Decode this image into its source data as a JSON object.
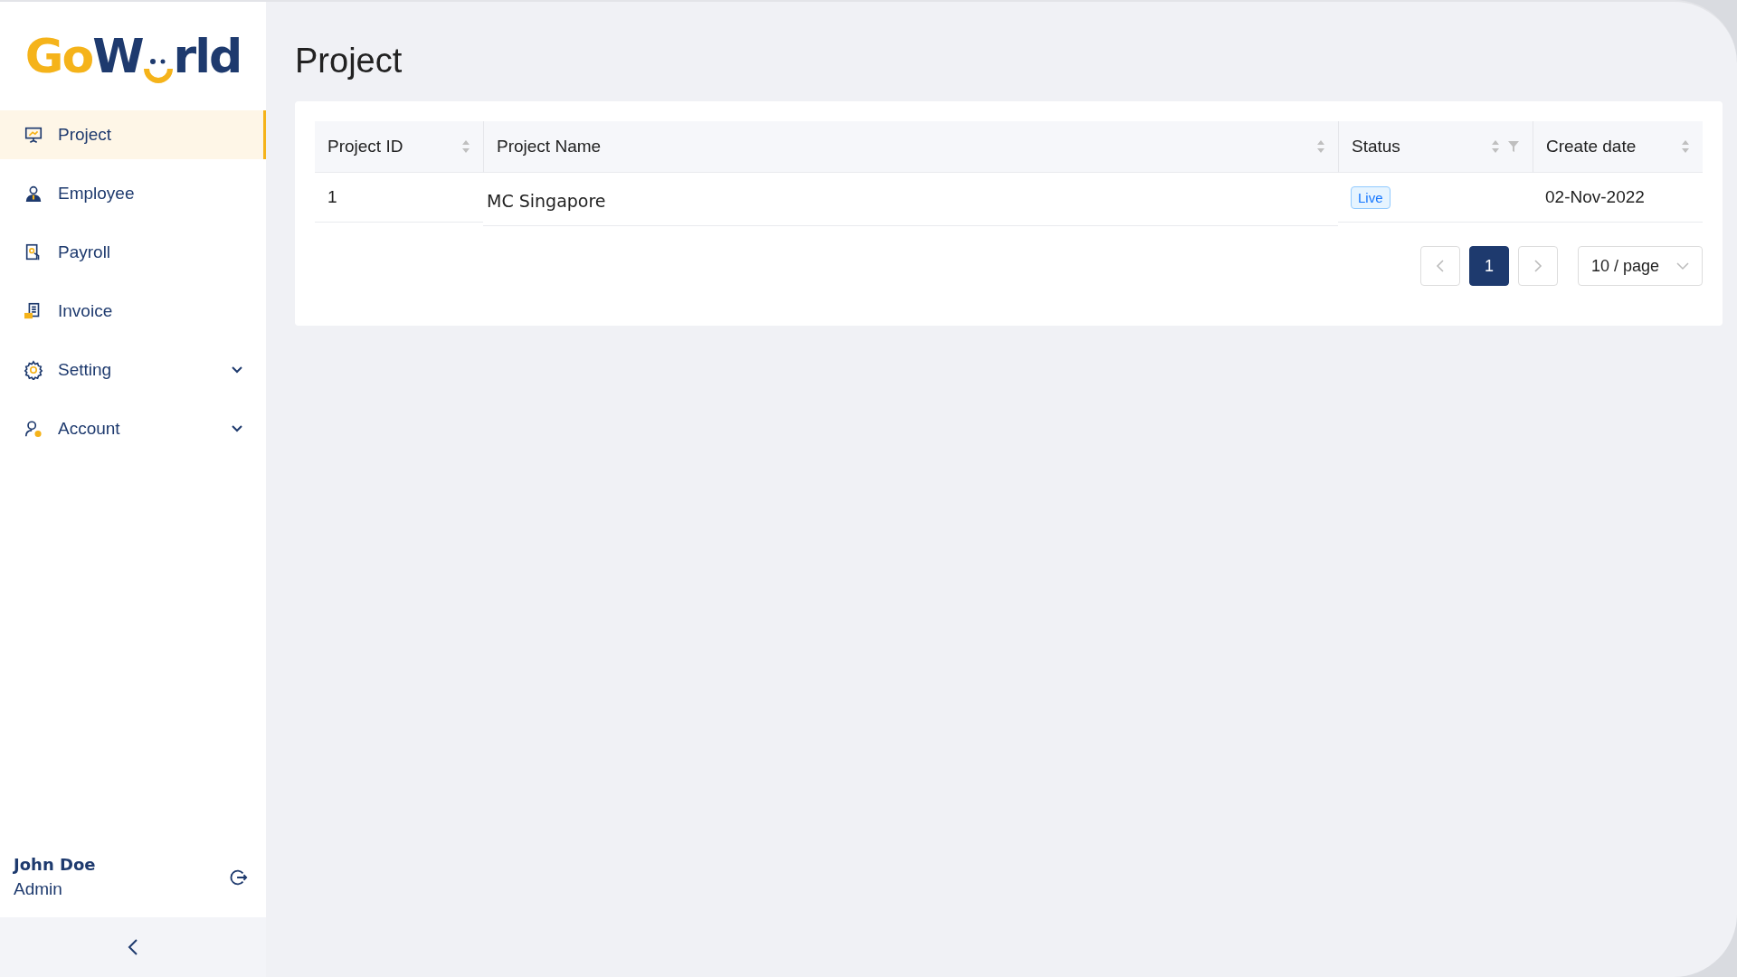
{
  "logo": {
    "lead": "Go",
    "middle": "W",
    "tail": "rld"
  },
  "sidebar": {
    "items": [
      {
        "label": "Project",
        "selected": true,
        "has_submenu": false
      },
      {
        "label": "Employee",
        "selected": false,
        "has_submenu": false
      },
      {
        "label": "Payroll",
        "selected": false,
        "has_submenu": false
      },
      {
        "label": "Invoice",
        "selected": false,
        "has_submenu": false
      },
      {
        "label": "Setting",
        "selected": false,
        "has_submenu": true
      },
      {
        "label": "Account",
        "selected": false,
        "has_submenu": true
      }
    ]
  },
  "user": {
    "name": "John Doe",
    "role": "Admin"
  },
  "page": {
    "title": "Project"
  },
  "table": {
    "columns": [
      {
        "label": "Project ID",
        "filterable": false
      },
      {
        "label": "Project Name",
        "filterable": false
      },
      {
        "label": "Status",
        "filterable": true
      },
      {
        "label": "Create date",
        "filterable": false
      }
    ],
    "rows": [
      {
        "id": "1",
        "name": "MC Singapore",
        "status": "Live",
        "date": "02-Nov-2022"
      }
    ]
  },
  "pagination": {
    "pages": [
      {
        "label": "1",
        "selected": true
      }
    ],
    "page_size": "10 / page"
  }
}
